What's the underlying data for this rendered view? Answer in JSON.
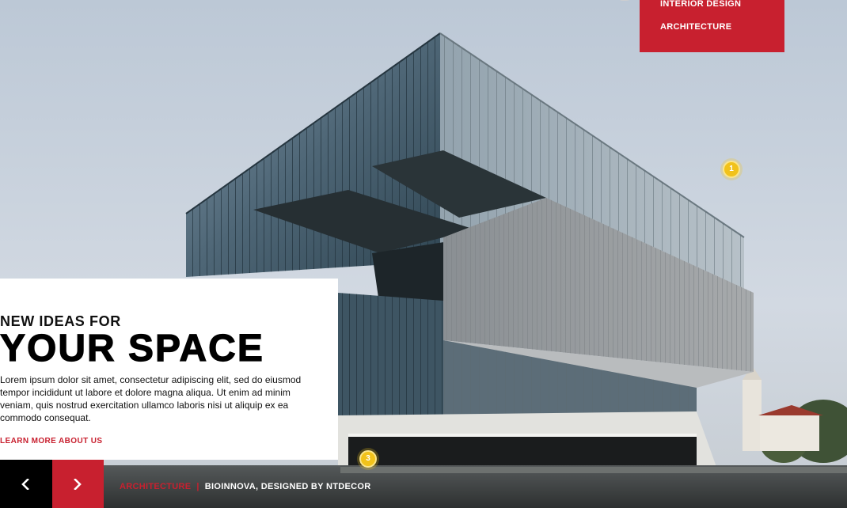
{
  "menu": {
    "items": [
      "INTERIOR DESIGN",
      "ARCHITECTURE"
    ],
    "accent": "#c8202f"
  },
  "hotspots": [
    "1",
    "3"
  ],
  "card": {
    "eyebrow": "NEW IDEAS FOR",
    "headline": "YOUR SPACE",
    "body": "Lorem ipsum dolor sit amet, consectetur adipiscing elit, sed do eiusmod tempor incididunt ut labore et dolore magna aliqua. Ut enim ad minim veniam, quis nostrud exercitation ullamco laboris nisi ut aliquip ex ea commodo consequat.",
    "cta": "LEARN MORE ABOUT US"
  },
  "slider": {
    "category": "ARCHITECTURE",
    "separator": "|",
    "title": "BIOINNOVA, DESIGNED BY NTDECOR",
    "prev_icon": "chevron-left-icon",
    "next_icon": "chevron-right-icon"
  },
  "colors": {
    "accent_red": "#c8202f",
    "hotspot_yellow": "#f1c21b",
    "sky": "#c9d3de"
  }
}
